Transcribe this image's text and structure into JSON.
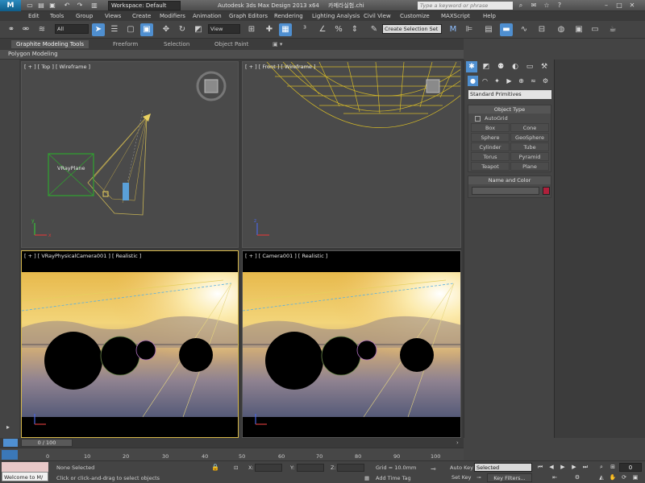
{
  "titlebar": {
    "workspace": "Workspace: Default",
    "title": "Autodesk 3ds Max Design 2013 x64",
    "file": "카메라실험.chi",
    "search_placeholder": "Type a keyword or phrase"
  },
  "menu": [
    "Edit",
    "Tools",
    "Group",
    "Views",
    "Create",
    "Modifiers",
    "Animation",
    "Graph Editors",
    "Rendering",
    "Lighting Analysis",
    "Civil View",
    "Customize",
    "MAXScript",
    "Help"
  ],
  "toolbar": {
    "selection_filter": "All",
    "ref_coord": "View",
    "named_selection": "Create Selection Set"
  },
  "ribbon": {
    "tabs": [
      "Graphite Modeling Tools",
      "Freeform",
      "Selection",
      "Object Paint"
    ],
    "panel": "Polygon Modeling"
  },
  "viewports": {
    "top_left": "[ + ] [ Top ] [ Wireframe ]",
    "top_right": "[ + ] [ Front ] [ Wireframe ]",
    "bottom_left": "[ + ] [ VRayPhysicalCamera001 ] [ Realistic ]",
    "bottom_right": "[ + ] [ Camera001 ] [ Realistic ]",
    "plane_label": "VRayPlane"
  },
  "cmdpanel": {
    "primitive_type": "Standard Primitives",
    "object_type_header": "Object Type",
    "autogrid": "AutoGrid",
    "buttons": [
      "Box",
      "Cone",
      "Sphere",
      "GeoSphere",
      "Cylinder",
      "Tube",
      "Torus",
      "Pyramid",
      "Teapot",
      "Plane"
    ],
    "name_color_header": "Name and Color"
  },
  "timeline": {
    "slider": "0 / 100",
    "ticks": [
      "0",
      "10",
      "20",
      "30",
      "40",
      "50",
      "60",
      "70",
      "80",
      "90",
      "100"
    ]
  },
  "status": {
    "welcome": "Welcome to M/",
    "selected": "None Selected",
    "hint": "Click or click-and-drag to select objects",
    "x_label": "X:",
    "y_label": "Y:",
    "z_label": "Z:",
    "grid": "Grid = 10.0mm",
    "add_time_tag": "Add Time Tag",
    "auto_key": "Auto Key",
    "set_key": "Set Key",
    "key_mode": "Selected",
    "key_filters": "Key Filters...",
    "frame": "0"
  },
  "colors": {
    "accent": "#4f8fd0",
    "active_viewport_border": "#d6b84a",
    "object_color": "#b0203b"
  }
}
